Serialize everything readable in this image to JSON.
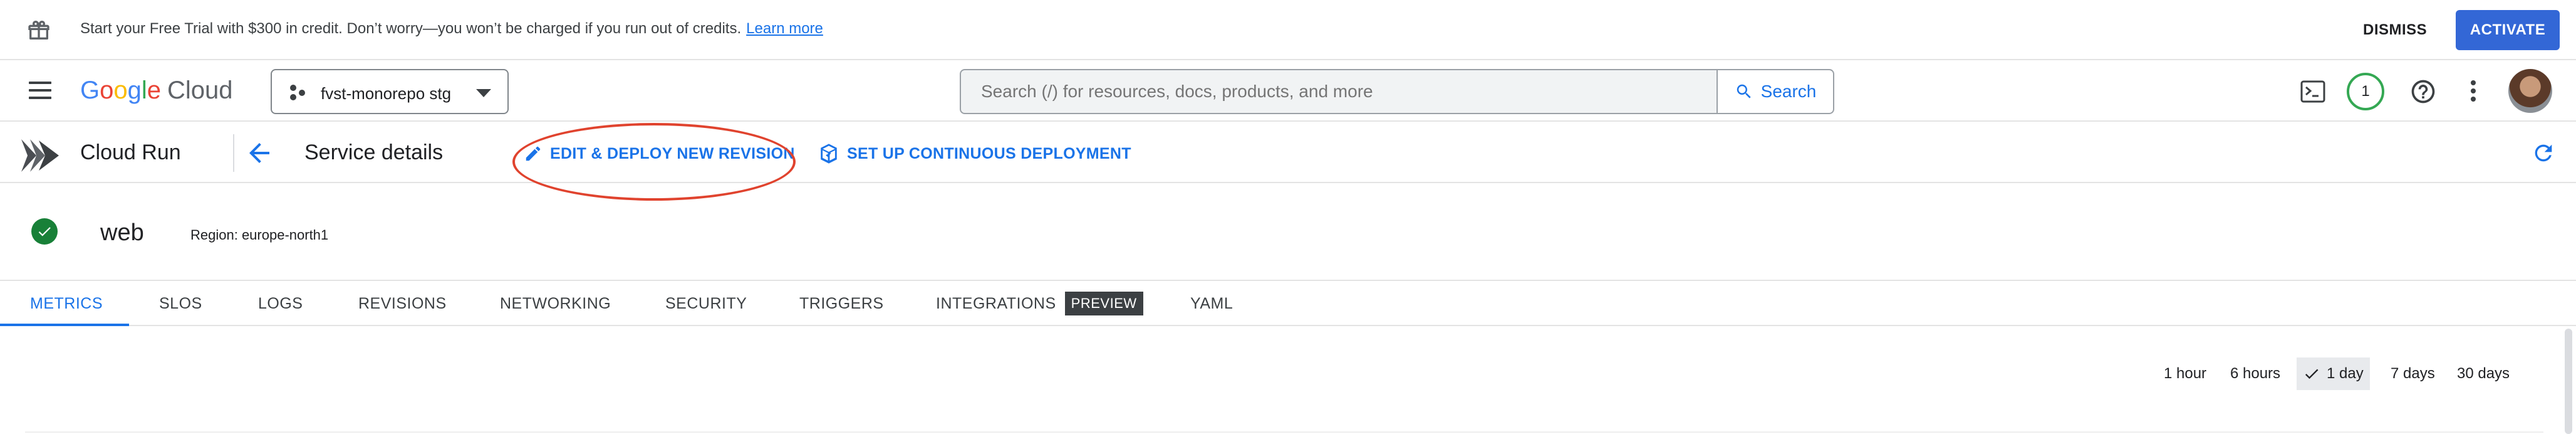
{
  "promo": {
    "icon": "gift-icon",
    "text": "Start your Free Trial with $300 in credit. Don’t worry—you won’t be charged if you run out of credits.",
    "link": "Learn more",
    "dismiss": "DISMISS",
    "activate": "ACTIVATE"
  },
  "appbar": {
    "logo_google": [
      "G",
      "o",
      "o",
      "g",
      "l",
      "e"
    ],
    "logo_cloud": "Cloud",
    "project": "fvst-monorepo stg",
    "search_placeholder": "Search (/) for resources, docs, products, and more",
    "search_button": "Search",
    "notifications_count": "1",
    "icons": [
      "menu-icon",
      "terminal-icon",
      "help-icon",
      "more-vert-icon",
      "avatar"
    ]
  },
  "service_bar": {
    "product": "Cloud Run",
    "title": "Service details",
    "edit_action": "EDIT & DEPLOY NEW REVISION",
    "setup_action": "SET UP CONTINUOUS DEPLOYMENT",
    "accent_color": "#1a73e8",
    "annotation_color": "#e0432e"
  },
  "service": {
    "name": "web",
    "region": "Region: europe-north1",
    "status": "ok",
    "status_color": "#188038"
  },
  "tabs": [
    {
      "label": "METRICS",
      "active": true
    },
    {
      "label": "SLOS"
    },
    {
      "label": "LOGS"
    },
    {
      "label": "REVISIONS"
    },
    {
      "label": "NETWORKING"
    },
    {
      "label": "SECURITY"
    },
    {
      "label": "TRIGGERS"
    },
    {
      "label": "INTEGRATIONS",
      "badge": "PREVIEW"
    },
    {
      "label": "YAML"
    }
  ],
  "time_ranges": [
    {
      "label": "1 hour"
    },
    {
      "label": "6 hours"
    },
    {
      "label": "1 day",
      "selected": true
    },
    {
      "label": "7 days"
    },
    {
      "label": "30 days"
    }
  ]
}
